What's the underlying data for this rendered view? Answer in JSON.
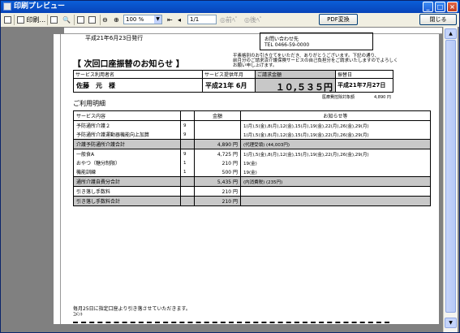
{
  "window": {
    "title": "印刷プレビュー",
    "min": "_",
    "max": "□",
    "close": "×"
  },
  "toolbar": {
    "print_label": "印刷...",
    "zoom": "100 %",
    "page": "1/1",
    "prev_label": "前ﾍﾟ",
    "next_label": "後ﾍﾟ",
    "pdf_label": "PDF変換",
    "close_label": "閉じる"
  },
  "doc": {
    "issue_date": "平成21年6月23日発行",
    "title": "【 次回口座振替のお知らせ 】",
    "contact_label": "お問い合わせ先",
    "contact_tel": "TEL 0466-59-0000",
    "notice_line1": "平素格別のお引き立てをいただき、ありがとうございます。下記の通り、",
    "notice_line2": "前月分のご請求済介護保険サービスの自己負担分をご請求いたしますのでよろしく",
    "notice_line3": "お願い申し上げます。",
    "user_label": "サービス利用者名",
    "user_name": "佐藤　元　様",
    "period_label": "サービス提供年月",
    "period_value": "平成21年 6月",
    "amount_label": "ご請求金額",
    "amount_value": "１０,５３５円",
    "debit_label": "振替日",
    "debit_value": "平成21年7月27日",
    "medical_label": "医療費控除対象額",
    "medical_value": "4,890 円",
    "section_title": "ご利用明細",
    "headers": [
      "サービス内容",
      "金額",
      "お知らせ等"
    ],
    "rows": [
      {
        "name": "予防通所介護２",
        "n": "9",
        "amount": "",
        "note": "1(月),5(金),8(月),12(金),15(月),19(金),22(月),26(金),29(月)"
      },
      {
        "name": "予防通所介護運動器機能向上加算",
        "n": "9",
        "amount": "",
        "note": "1(月),5(金),8(月),12(金),15(月),19(金),22(月),26(金),29(月)"
      },
      {
        "name": "介護予防通所介護合計",
        "n": "",
        "amount": "4,890 円",
        "note": "(代理受領) (44,003円)"
      },
      {
        "name": "一般食A",
        "n": "9",
        "amount": "4,725 円",
        "note": "1(月),5(金),8(月),12(金),15(月),19(金),22(月),26(金),29(月)"
      },
      {
        "name": "おやつ（糖分制限）",
        "n": "1",
        "amount": "210 円",
        "note": "19(金)"
      },
      {
        "name": "機能訓練",
        "n": "1",
        "amount": "500 円",
        "note": "19(金)"
      },
      {
        "name": "通所介護自費分合計",
        "n": "",
        "amount": "5,435 円",
        "note": "(内消費税) (235円)"
      },
      {
        "name": "引き落し手数料",
        "n": "",
        "amount": "210 円",
        "note": ""
      },
      {
        "name": "引き落し手数料合計",
        "n": "",
        "amount": "210 円",
        "note": ""
      }
    ],
    "footer_line1": "毎月25日に指定口座より引き落させていただきます。",
    "footer_line2": "ｺﾒﾝﾄ"
  }
}
